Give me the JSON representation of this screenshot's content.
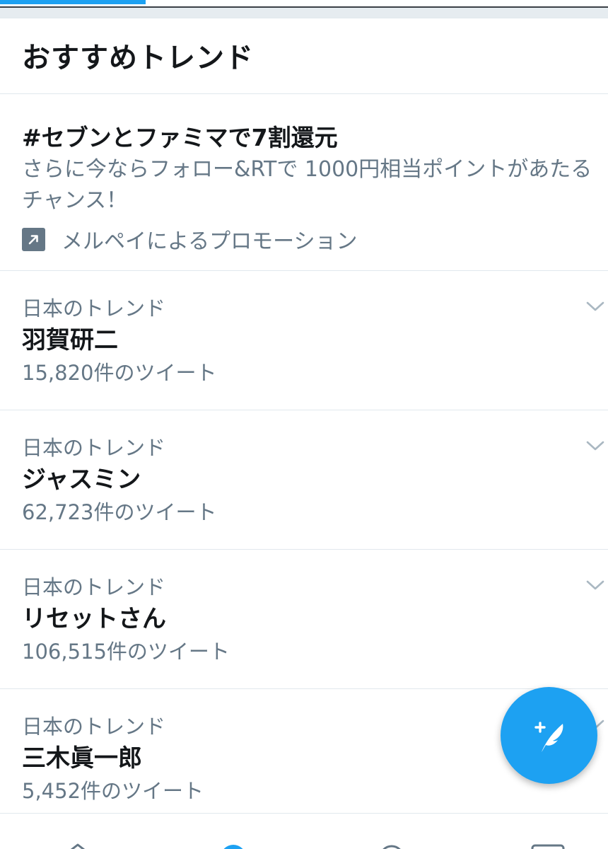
{
  "header": {
    "title": "おすすめトレンド"
  },
  "promo": {
    "title": "#セブンとファミマで7割還元",
    "description": "さらに今ならフォロー&RTで 1000円相当ポイントがあたるチャンス！",
    "promoted_by": "メルペイによるプロモーション",
    "icon": "promoted-arrow-icon"
  },
  "trends": [
    {
      "context": "日本のトレンド",
      "name": "羽賀研二",
      "count": "15,820件のツイート"
    },
    {
      "context": "日本のトレンド",
      "name": "ジャスミン",
      "count": "62,723件のツイート"
    },
    {
      "context": "日本のトレンド",
      "name": "リセットさん",
      "count": "106,515件のツイート"
    },
    {
      "context": "日本のトレンド",
      "name": "三木眞一郎",
      "count": "5,452件のツイート"
    }
  ],
  "fab": {
    "icon": "compose-tweet-icon"
  },
  "bottom_nav": {
    "items": [
      "home-icon",
      "explore-icon",
      "notifications-icon",
      "messages-icon"
    ],
    "active_index": 1
  },
  "colors": {
    "accent": "#1da1f2",
    "text_primary": "#14171a",
    "text_secondary": "#657786",
    "divider": "#e1e8ed",
    "background": "#e6ecf0"
  }
}
